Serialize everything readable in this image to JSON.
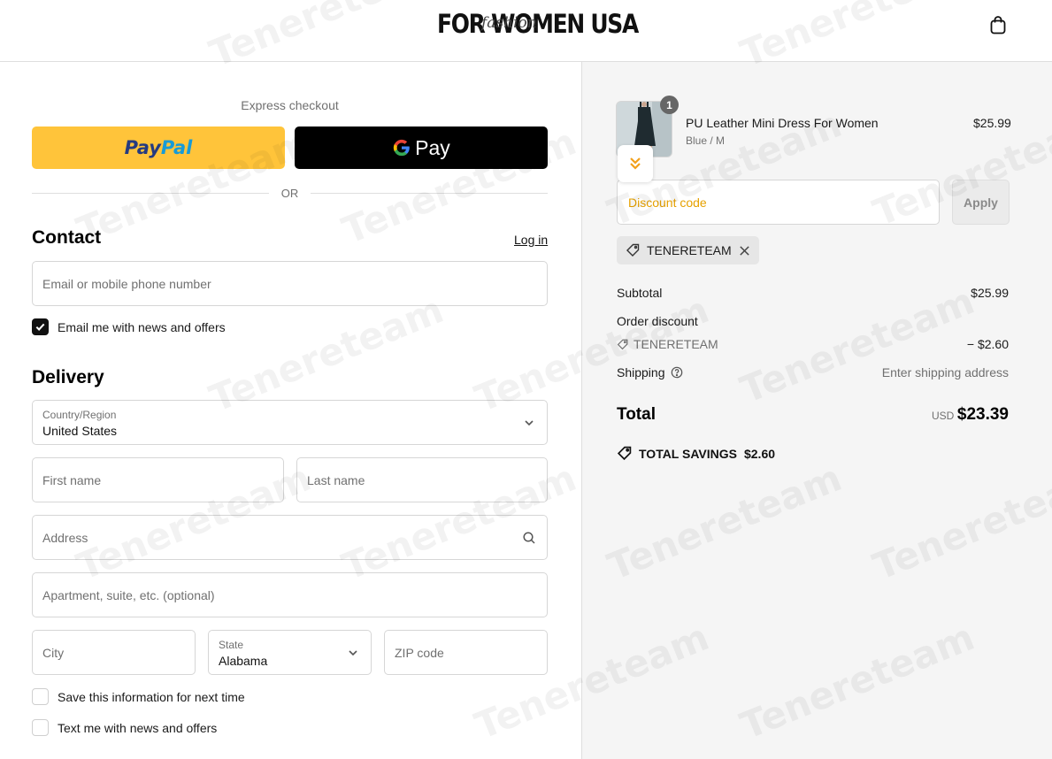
{
  "header": {
    "logo_text": "FOR WOMEN USA",
    "logo_script": "fashion",
    "cart_icon": "shopping-bag-icon"
  },
  "express": {
    "title": "Express checkout",
    "paypal_label_1": "Pay",
    "paypal_label_2": "Pal",
    "gpay_g": "G",
    "gpay_label": "Pay",
    "or_text": "OR"
  },
  "contact": {
    "title": "Contact",
    "login": "Log in",
    "email_placeholder": "Email or mobile phone number",
    "news_label": "Email me with news and offers",
    "news_checked": true
  },
  "delivery": {
    "title": "Delivery",
    "country_label": "Country/Region",
    "country_value": "United States",
    "first_name": "First name",
    "last_name": "Last name",
    "address": "Address",
    "apartment": "Apartment, suite, etc. (optional)",
    "city": "City",
    "state_label": "State",
    "state_value": "Alabama",
    "zip": "ZIP code",
    "save_info": "Save this information for next time",
    "text_offers": "Text me with news and offers"
  },
  "order": {
    "product_name": "PU Leather Mini Dress For Women",
    "variant": "Blue / M",
    "price": "$25.99",
    "quantity": "1",
    "discount_placeholder": "Discount code",
    "apply": "Apply",
    "applied_code": "TENERETEAM",
    "subtotal_label": "Subtotal",
    "subtotal": "$25.99",
    "order_discount_label": "Order discount",
    "discount_code": "TENERETEAM",
    "discount_amount": "− $2.60",
    "shipping_label": "Shipping",
    "shipping_value": "Enter shipping address",
    "total_label": "Total",
    "currency": "USD",
    "total": "$23.39",
    "savings_label": "TOTAL SAVINGS",
    "savings": "$2.60"
  },
  "watermark": "Tenereteam",
  "colors": {
    "paypal_yellow": "#ffc43a",
    "paypal_dark_blue": "#253b80",
    "paypal_light_blue": "#179bd7",
    "discount_placeholder": "#e6a100",
    "sidebar_bg": "#f5f5f5"
  }
}
